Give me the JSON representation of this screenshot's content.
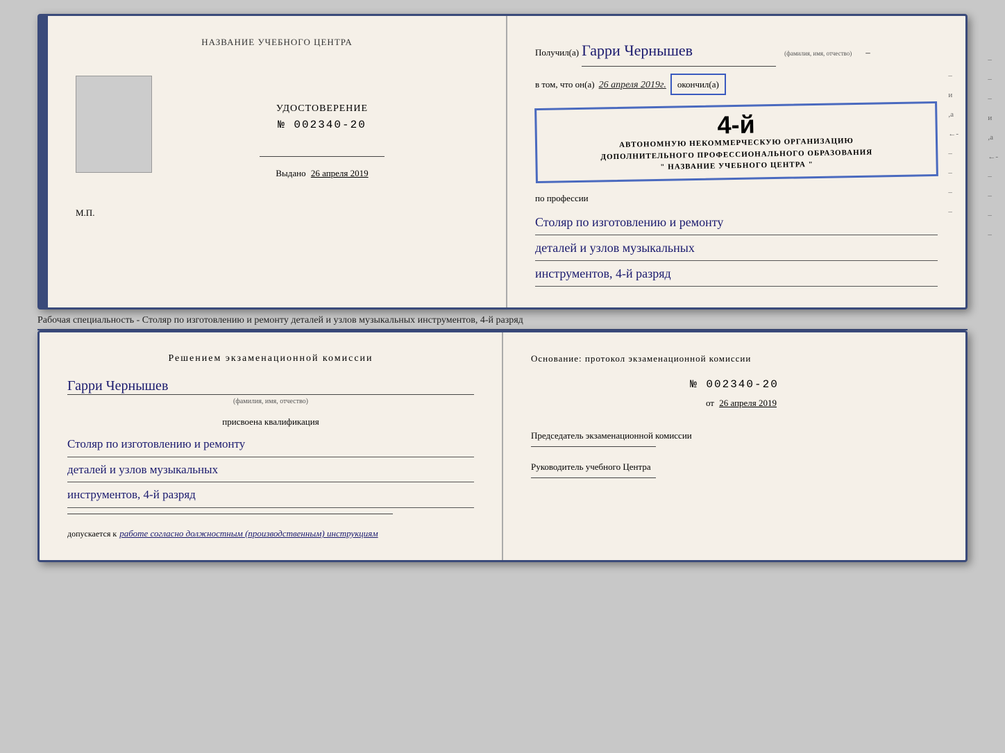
{
  "top_booklet": {
    "left": {
      "header": "НАЗВАНИЕ УЧЕБНОГО ЦЕНТРА",
      "udostoverenie_title": "УДОСТОВЕРЕНИЕ",
      "udostoverenie_num": "№ 002340-20",
      "vydano_label": "Выдано",
      "vydano_date": "26 апреля 2019",
      "mp_label": "М.П."
    },
    "right": {
      "poluchil_label": "Получил(а)",
      "recipient_name": "Гарри Чернышев",
      "fio_label": "(фамилия, имя, отчество)",
      "vtom_label": "в том, что он(а)",
      "date_value": "26 апреля 2019г.",
      "okonchil_label": "окончил(а)",
      "stamp_number": "4-й",
      "stamp_line1": "АВТОНОМНУЮ НЕКОММЕРЧЕСКУЮ ОРГАНИЗАЦИЮ",
      "stamp_line2": "ДОПОЛНИТЕЛЬНОГО ПРОФЕССИОНАЛЬНОГО ОБРАЗОВАНИЯ",
      "stamp_line3": "\" НАЗВАНИЕ УЧЕБНОГО ЦЕНТРА \"",
      "po_professii_label": "по профессии",
      "profession_line1": "Столяр по изготовлению и ремонту",
      "profession_line2": "деталей и узлов музыкальных",
      "profession_line3": "инструментов, 4-й разряд"
    }
  },
  "subtitle": "Рабочая специальность - Столяр по изготовлению и ремонту деталей и узлов музыкальных инструментов, 4-й разряд",
  "bottom_booklet": {
    "left": {
      "resheniyem_title": "Решением экзаменационной комиссии",
      "recipient_name": "Гарри Чернышев",
      "fio_label": "(фамилия, имя, отчество)",
      "prisvoena_label": "присвоена квалификация",
      "qualification_line1": "Столяр по изготовлению и ремонту",
      "qualification_line2": "деталей и узлов музыкальных",
      "qualification_line3": "инструментов, 4-й разряд",
      "dopuskaetsya_label": "допускается к",
      "dopuskaetsya_value": "работе согласно должностным (производственным) инструкциям"
    },
    "right": {
      "osnovanie_label": "Основание: протокол экзаменационной комиссии",
      "protocol_num": "№ 002340-20",
      "ot_label": "от",
      "ot_date": "26 апреля 2019",
      "predsedatel_label": "Председатель экзаменационной комиссии",
      "rukovoditel_label": "Руководитель учебного Центра"
    }
  },
  "right_edge_chars": [
    "и",
    "а",
    "←",
    "–",
    "–",
    "–",
    "–"
  ]
}
